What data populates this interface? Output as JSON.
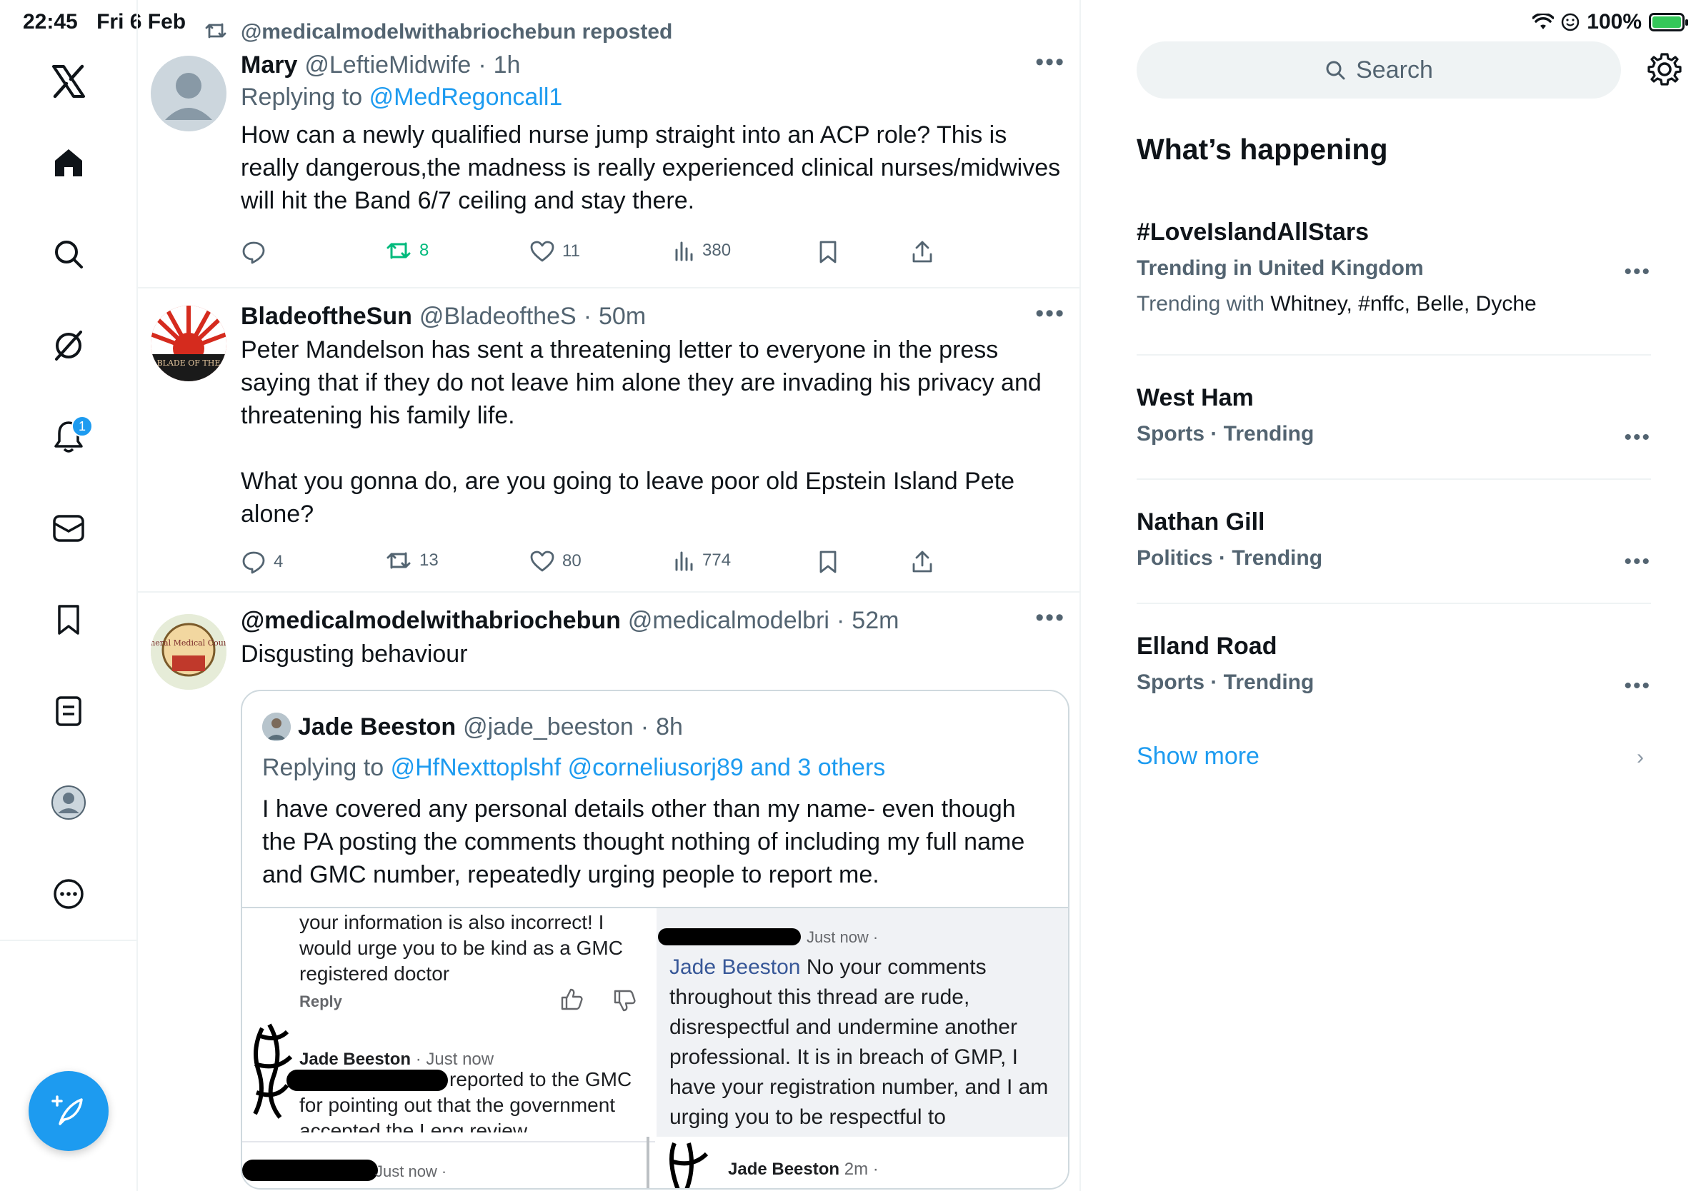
{
  "status_bar": {
    "time": "22:45",
    "date": "Fri 6 Feb",
    "battery": "100%"
  },
  "nav": {
    "notifications_badge": "1"
  },
  "timeline": {
    "tweet1": {
      "social_context": "@medicalmodelwithabriochebun reposted",
      "name": "Mary",
      "handle": "@LeftieMidwife",
      "time": "1h",
      "replying_label": "Replying to",
      "replying_to": "@MedRegoncall1",
      "text": "How can a newly qualified nurse jump straight into an ACP role? This is really dangerous,the madness is really experienced clinical nurses/midwives will hit the Band 6/7 ceiling and stay there.",
      "replies": "",
      "reposts": "8",
      "likes": "11",
      "views": "380"
    },
    "tweet2": {
      "name": "BladeoftheSun",
      "handle": "@BladeoftheS",
      "time": "50m",
      "avatar_text": "BLADE OF THE",
      "text": "Peter Mandelson has sent a threatening letter to everyone in the press saying that if they do not leave him alone they are invading his privacy and threatening his family life.\n\nWhat you gonna do, are you going to leave poor old Epstein Island Pete alone?",
      "replies": "4",
      "reposts": "13",
      "likes": "80",
      "views": "774"
    },
    "tweet3": {
      "name": "@medicalmodelwithabriochebun",
      "handle": "@medicalmodelbri",
      "time": "52m",
      "avatar_text": "General Medical Council",
      "text": "Disgusting behaviour",
      "quote": {
        "name": "Jade Beeston",
        "handle": "@jade_beeston",
        "time": "8h",
        "replying_label": "Replying to",
        "replying_to": "@HfNexttoplshf @corneliusorj89 and 3 others",
        "text": "I have covered any personal details other than my name- even though the PA posting the comments thought nothing of including my full name and GMC number, repeatedly urging people to report me.",
        "image": {
          "left_comment_text": "your information is also incorrect! I would urge you to be kind as a GMC registered doctor",
          "left_reply_label": "Reply",
          "left_name": "Jade Beeston",
          "left_time": "· Just now",
          "left_text_1": "reported to the GMC",
          "left_text_2": "for pointing out that the government",
          "left_text_3": "accepted the Leng review",
          "bottom_left_time": "Just now ·",
          "right_time": "Just now ·",
          "right_mention": "Jade Beeston",
          "right_text": " No your comments throughout this thread are rude, disrespectful and undermine another professional. It is in breach of GMP, I have your registration number, and I am urging you to be respectful to",
          "bottom_right_name": "Jade Beeston",
          "bottom_right_time": "2m ·"
        }
      }
    }
  },
  "right": {
    "search_placeholder": "Search",
    "section_title": "What’s happening",
    "trends": [
      {
        "name": "#LoveIslandAllStars",
        "meta": "Trending in United Kingdom",
        "with_label": "Trending with",
        "with": "Whitney, #nffc, Belle, Dyche"
      },
      {
        "name": "West Ham",
        "meta": "Sports · Trending"
      },
      {
        "name": "Nathan Gill",
        "meta": "Politics · Trending"
      },
      {
        "name": "Elland Road",
        "meta": "Sports · Trending"
      }
    ],
    "show_more": "Show more"
  },
  "colors": {
    "accent": "#1d9bf0",
    "repost_green": "#00ba7c",
    "secondary_text": "#536471"
  }
}
